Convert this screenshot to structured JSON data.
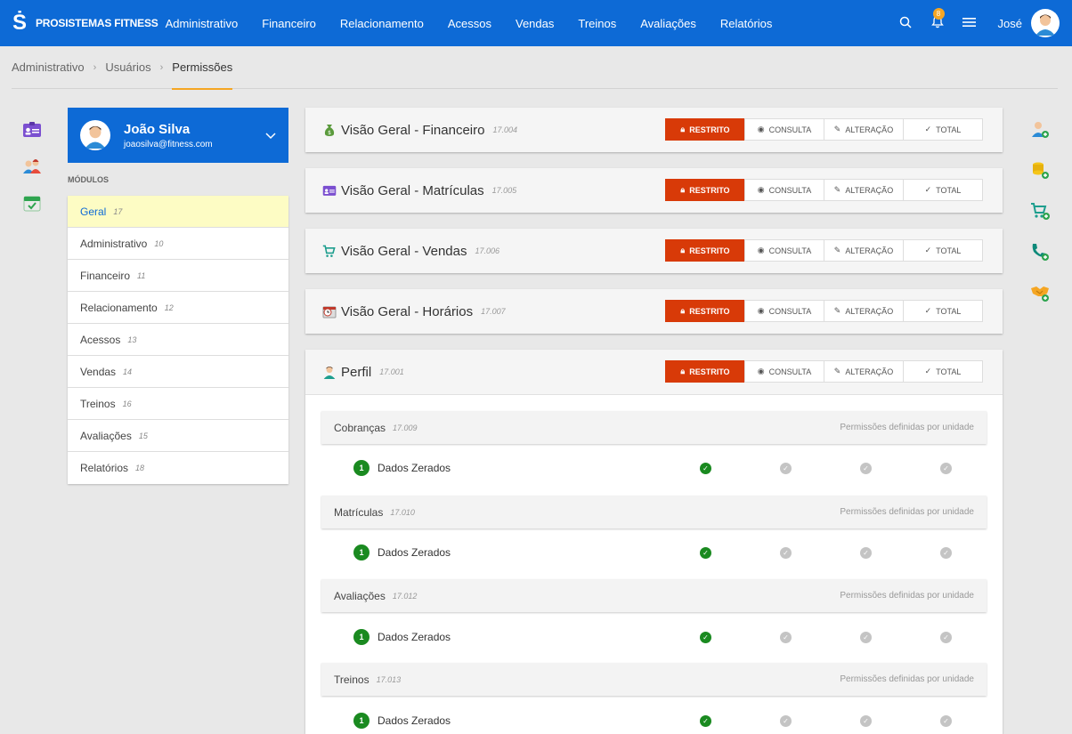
{
  "app": {
    "brand": "PROSISTEMAS FITNESS",
    "logo": "Ṡ"
  },
  "nav": [
    "Administrativo",
    "Financeiro",
    "Relacionamento",
    "Acessos",
    "Vendas",
    "Treinos",
    "Avaliações",
    "Relatórios"
  ],
  "topbar": {
    "notifications": "8",
    "user": "José"
  },
  "breadcrumb": [
    "Administrativo",
    "Usuários",
    "Permissões"
  ],
  "user": {
    "name": "João Silva",
    "email": "joaosilva@fitness.com"
  },
  "modules_label": "MÓDULOS",
  "modules": [
    {
      "label": "Geral",
      "count": "17"
    },
    {
      "label": "Administrativo",
      "count": "10"
    },
    {
      "label": "Financeiro",
      "count": "11"
    },
    {
      "label": "Relacionamento",
      "count": "12"
    },
    {
      "label": "Acessos",
      "count": "13"
    },
    {
      "label": "Vendas",
      "count": "14"
    },
    {
      "label": "Treinos",
      "count": "16"
    },
    {
      "label": "Avaliações",
      "count": "15"
    },
    {
      "label": "Relatórios",
      "count": "18"
    }
  ],
  "buttons": {
    "restrito": "RESTRITO",
    "consulta": "CONSULTA",
    "alteracao": "ALTERAÇÃO",
    "total": "TOTAL"
  },
  "permissions": [
    {
      "title": "Visão Geral - Financeiro",
      "code": "17.004",
      "icon": "money-bag-icon"
    },
    {
      "title": "Visão Geral - Matrículas",
      "code": "17.005",
      "icon": "id-card-icon"
    },
    {
      "title": "Visão Geral - Vendas",
      "code": "17.006",
      "icon": "cart-icon"
    },
    {
      "title": "Visão Geral - Horários",
      "code": "17.007",
      "icon": "calendar-clock-icon"
    }
  ],
  "perfil": {
    "title": "Perfil",
    "code": "17.001",
    "note": "Permissões definidas por unidade",
    "groups": [
      {
        "title": "Cobranças",
        "code": "17.009",
        "row_badge": "1",
        "row_label": "Dados Zerados"
      },
      {
        "title": "Matrículas",
        "code": "17.010",
        "row_badge": "1",
        "row_label": "Dados Zerados"
      },
      {
        "title": "Avaliações",
        "code": "17.012",
        "row_badge": "1",
        "row_label": "Dados Zerados"
      },
      {
        "title": "Treinos",
        "code": "17.013",
        "row_badge": "1",
        "row_label": "Dados Zerados"
      }
    ]
  },
  "colors": {
    "primary": "#0d6ad6",
    "accent": "#f5a623",
    "restrito": "#d83a08",
    "check": "#1a8a20"
  }
}
